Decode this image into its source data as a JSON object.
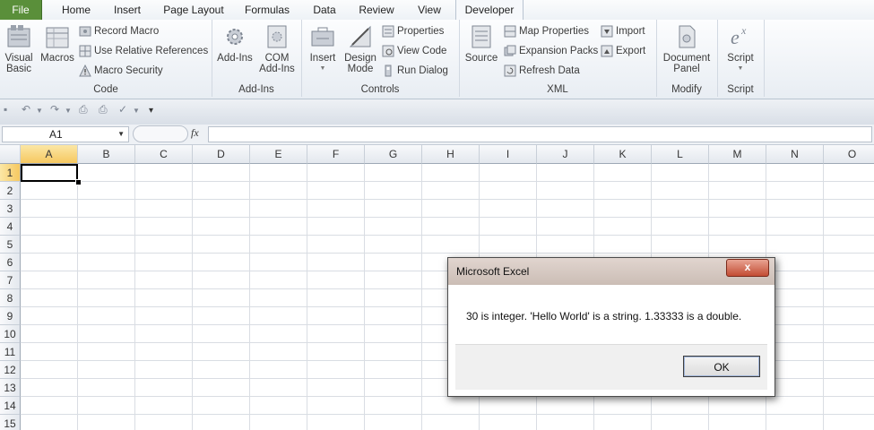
{
  "tabs": [
    "File",
    "Home",
    "Insert",
    "Page Layout",
    "Formulas",
    "Data",
    "Review",
    "View",
    "Developer"
  ],
  "ribbon": {
    "code": {
      "label": "Code",
      "visual_basic": "Visual Basic",
      "macros": "Macros",
      "record_macro": "Record Macro",
      "use_relative": "Use Relative References",
      "macro_security": "Macro Security"
    },
    "addins": {
      "label": "Add-Ins",
      "addins": "Add-Ins",
      "com_addins": "COM Add-Ins"
    },
    "controls": {
      "label": "Controls",
      "insert": "Insert",
      "design_mode": "Design Mode",
      "properties": "Properties",
      "view_code": "View Code",
      "run_dialog": "Run Dialog"
    },
    "xml": {
      "label": "XML",
      "source": "Source",
      "map_properties": "Map Properties",
      "expansion_packs": "Expansion Packs",
      "refresh_data": "Refresh Data",
      "import": "Import",
      "export": "Export"
    },
    "modify": {
      "label": "Modify",
      "document_panel": "Document Panel"
    },
    "script": {
      "label": "Script",
      "script": "Script"
    }
  },
  "formula_bar": {
    "name_box": "A1",
    "fx": "fx",
    "formula": ""
  },
  "columns": [
    "A",
    "B",
    "C",
    "D",
    "E",
    "F",
    "G",
    "H",
    "I",
    "J",
    "K",
    "L",
    "M",
    "N",
    "O"
  ],
  "rows": [
    "1",
    "2",
    "3",
    "4",
    "5",
    "6",
    "7",
    "8",
    "9",
    "10",
    "11",
    "12",
    "13",
    "14",
    "15"
  ],
  "selected_cell": "A1",
  "dialog": {
    "title": "Microsoft Excel",
    "close": "x",
    "message": "30 is integer. 'Hello World' is a string. 1.33333 is a double.",
    "ok": "OK"
  },
  "colors": {
    "file_tab": "#5a8f3a",
    "selection": "#000000",
    "dialog_titlebar": "#d5c8c1",
    "close_button": "#c34c33"
  }
}
